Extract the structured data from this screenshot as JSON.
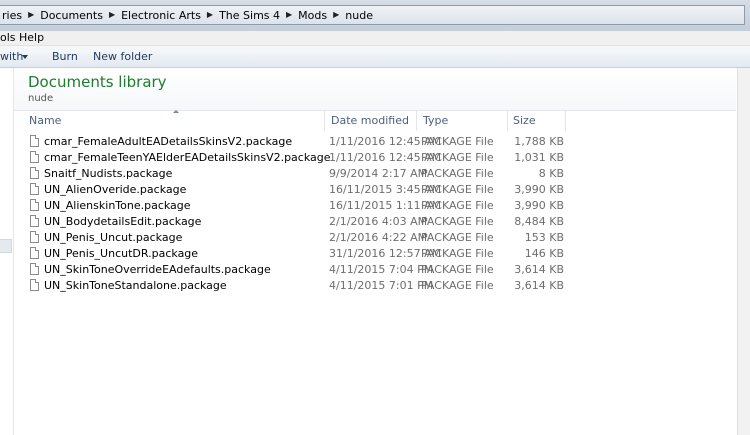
{
  "address": {
    "crumbs": [
      "ries",
      "Documents",
      "Electronic Arts",
      "The Sims 4",
      "Mods",
      "nude"
    ]
  },
  "menu": {
    "items": [
      "ols",
      "Help"
    ]
  },
  "toolbar": {
    "share_label": "with",
    "burn_label": "Burn",
    "new_folder_label": "New folder"
  },
  "library": {
    "title": "Documents library",
    "subtitle": "nude"
  },
  "columns": {
    "name": "Name",
    "date": "Date modified",
    "type": "Type",
    "size": "Size"
  },
  "files": [
    {
      "name": "cmar_FemaleAdultEADetailsSkinsV2.package",
      "date": "1/11/2016 12:45 AM",
      "type": "PACKAGE File",
      "size": "1,788 KB"
    },
    {
      "name": "cmar_FemaleTeenYAElderEADetailsSkinsV2.package",
      "date": "1/11/2016 12:45 AM",
      "type": "PACKAGE File",
      "size": "1,031 KB"
    },
    {
      "name": "Snaitf_Nudists.package",
      "date": "9/9/2014 2:17 AM",
      "type": "PACKAGE File",
      "size": "8 KB"
    },
    {
      "name": "UN_AlienOveride.package",
      "date": "16/11/2015 3:45 AM",
      "type": "PACKAGE File",
      "size": "3,990 KB"
    },
    {
      "name": "UN_AlienskinTone.package",
      "date": "16/11/2015 1:11 AM",
      "type": "PACKAGE File",
      "size": "3,990 KB"
    },
    {
      "name": "UN_BodydetailsEdit.package",
      "date": "2/1/2016 4:03 AM",
      "type": "PACKAGE File",
      "size": "8,484 KB"
    },
    {
      "name": "UN_Penis_Uncut.package",
      "date": "2/1/2016 4:22 AM",
      "type": "PACKAGE File",
      "size": "153 KB"
    },
    {
      "name": "UN_Penis_UncutDR.package",
      "date": "31/1/2016 12:57 AM",
      "type": "PACKAGE File",
      "size": "146 KB"
    },
    {
      "name": "UN_SkinToneOverrideEAdefaults.package",
      "date": "4/11/2015 7:04 PM",
      "type": "PACKAGE File",
      "size": "3,614 KB"
    },
    {
      "name": "UN_SkinToneStandalone.package",
      "date": "4/11/2015 7:01 PM",
      "type": "PACKAGE File",
      "size": "3,614 KB"
    }
  ],
  "icons": {
    "file": "document-file-icon",
    "crumb_separator": "chevron-right-icon",
    "dropdown": "chevron-down-icon",
    "sort": "sort-ascending-icon"
  }
}
